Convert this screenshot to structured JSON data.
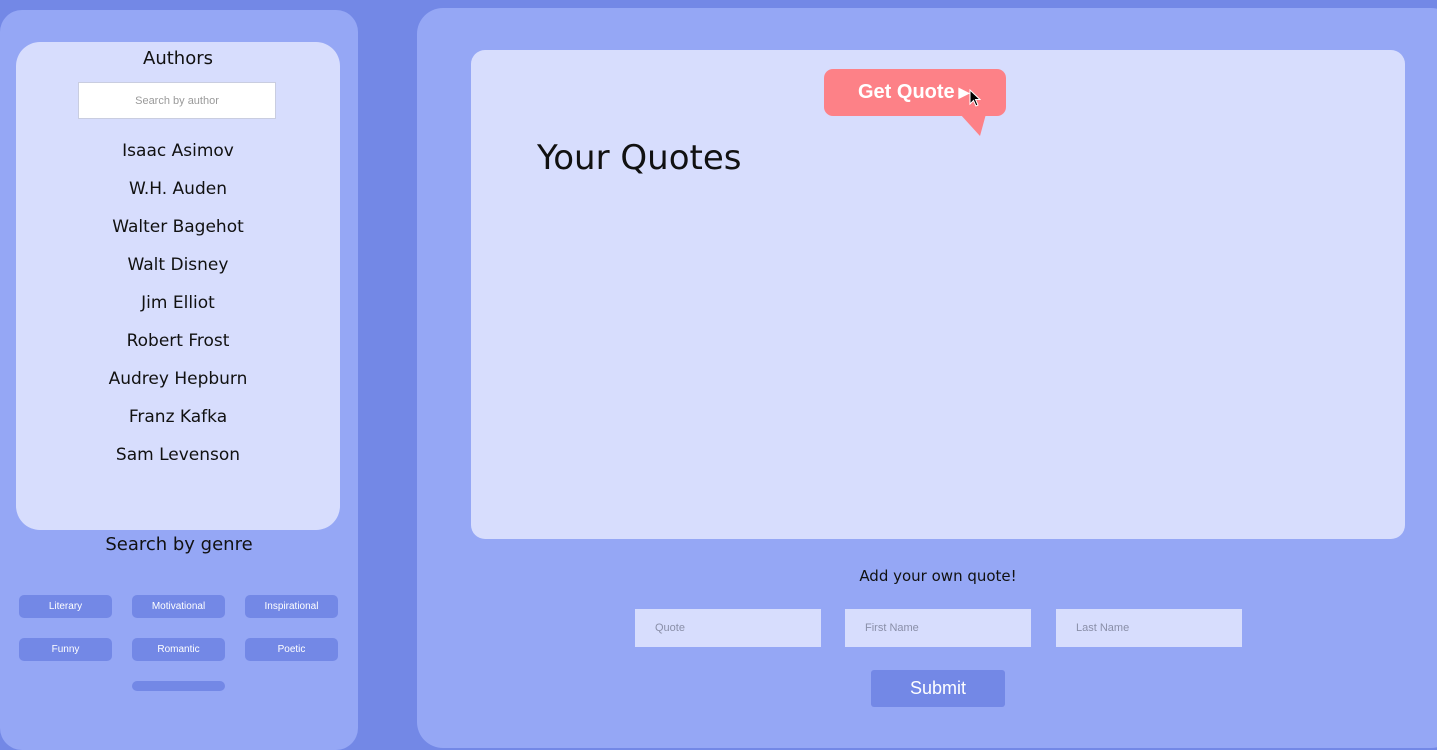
{
  "sidebar": {
    "authors_title": "Authors",
    "author_search_placeholder": "Search by author",
    "authors": [
      "Isaac Asimov",
      "W.H. Auden",
      "Walter Bagehot",
      "Walt Disney",
      "Jim Elliot",
      "Robert Frost",
      "Audrey Hepburn",
      "Franz Kafka",
      "Sam Levenson"
    ],
    "genre_title": "Search by genre",
    "genres": [
      "Literary",
      "Motivational",
      "Inspirational",
      "Funny",
      "Romantic",
      "Poetic"
    ]
  },
  "main": {
    "get_quote_label": "Get Quote",
    "get_quote_glyph": "▶",
    "quotes_title": "Your Quotes",
    "add_title": "Add your own quote!",
    "quote_placeholder": "Quote",
    "first_name_placeholder": "First Name",
    "last_name_placeholder": "Last Name",
    "submit_label": "Submit"
  },
  "colors": {
    "background": "#7388e6",
    "panel": "#95a7f5",
    "card": "#d7ddfd",
    "accent": "#fd8187",
    "button": "#7388e6"
  }
}
